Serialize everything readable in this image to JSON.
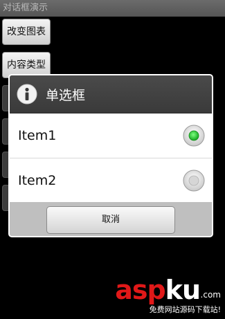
{
  "app": {
    "title": "对话框演示"
  },
  "activity": {
    "buttons": [
      {
        "label": "改变图表"
      },
      {
        "label": "内容类型"
      }
    ]
  },
  "dialog": {
    "title": "单选框",
    "icon": "info-icon",
    "items": [
      {
        "label": "Item1",
        "selected": true
      },
      {
        "label": "Item2",
        "selected": false
      }
    ],
    "cancel_label": "取消"
  },
  "watermark": {
    "brand_red": "asp",
    "brand_white": "ku",
    "domain": ".com",
    "tagline": "免费网站源码下载站!"
  },
  "colors": {
    "selected_radio": "#22c02a",
    "brand_red": "#e01818"
  }
}
